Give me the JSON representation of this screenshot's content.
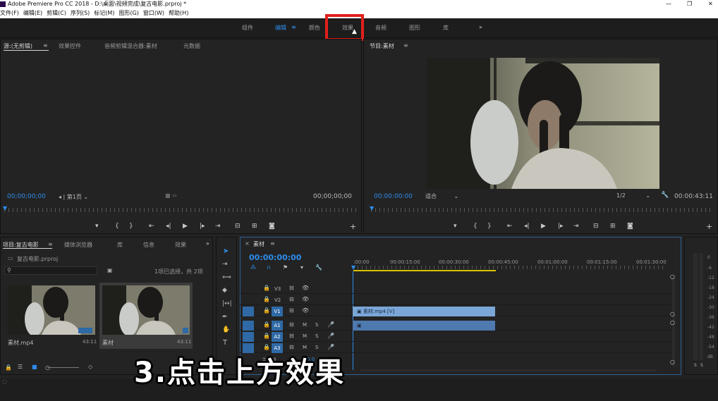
{
  "window": {
    "title": "Adobe Premiere Pro CC 2018 - D:\\桌面\\视频完成\\复古电影.prproj *"
  },
  "menu": [
    "文件(F)",
    "编辑(E)",
    "剪辑(C)",
    "序列(S)",
    "标记(M)",
    "图形(G)",
    "窗口(W)",
    "帮助(H)"
  ],
  "workspaces": {
    "items": [
      "组件",
      "编辑",
      "颜色",
      "效果",
      "音频",
      "图形",
      "库"
    ],
    "active": "编辑",
    "more": "»"
  },
  "source_panel": {
    "tabs": [
      "源:(无剪辑)",
      "效果控件",
      "音频剪辑混合器:素材",
      "元数据"
    ],
    "timecode_in": "00;00;00;00",
    "page_select": "第1页",
    "timecode_out": "00;00;00;00"
  },
  "program_panel": {
    "title": "节目:素材",
    "timecode": "00:00:00:00",
    "fit": "适合",
    "resolution": "1/2",
    "duration": "00:00:43:11"
  },
  "project_panel": {
    "tabs": [
      "项目:复古电影",
      "媒体浏览器",
      "库",
      "信息",
      "效果"
    ],
    "file": "复古电影.prproj",
    "selection_info": "1项已选择，共 2项",
    "items": [
      {
        "name": "素材.mp4",
        "duration": "43:11"
      },
      {
        "name": "素材",
        "duration": "43:11"
      }
    ]
  },
  "timeline": {
    "tab": "素材",
    "timecode": "00:00:00:00",
    "ruler": [
      ":00:00",
      "00:00:15:00",
      "00:00:30:00",
      "00:00:45:00",
      "00:01:00:00",
      "00:01:15:00",
      "00:01:30:00"
    ],
    "video_tracks": [
      "V3",
      "V2",
      "V1"
    ],
    "audio_tracks": [
      "A1",
      "A2",
      "A3"
    ],
    "clip_label": "素材.mp4 [V]",
    "master": "主声道",
    "master_value": "0.0"
  },
  "meter": {
    "labels": [
      "0",
      "-6",
      "-12",
      "-18",
      "-24",
      "-30",
      "-36",
      "-42",
      "-48",
      "-54",
      "dB"
    ],
    "solo": [
      "S",
      "S"
    ]
  },
  "caption": "3.点击上方效果"
}
